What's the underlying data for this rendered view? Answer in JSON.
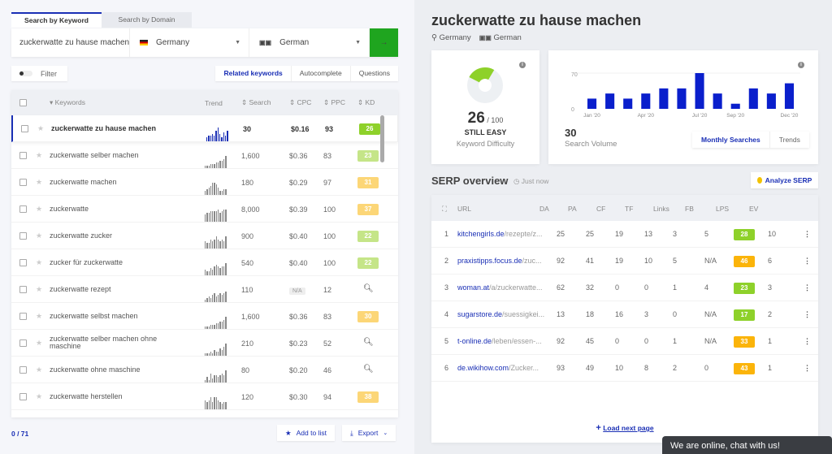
{
  "search": {
    "tabs": [
      "Search by Keyword",
      "Search by Domain"
    ],
    "keyword_value": "zuckerwatte zu hause machen",
    "country": "Germany",
    "language": "German",
    "go_icon": "arrow-right-icon"
  },
  "filter_label": "Filter",
  "modes": [
    "Related keywords",
    "Autocomplete",
    "Questions"
  ],
  "table": {
    "headers": {
      "keywords": "Keywords",
      "trend": "Trend",
      "search": "Search",
      "cpc": "CPC",
      "ppc": "PPC",
      "kd": "KD"
    },
    "rows": [
      {
        "kw": "zuckerwatte zu hause machen",
        "search": "30",
        "cpc": "$0.16",
        "ppc": "93",
        "kd": "26",
        "kd_color": "#8ed12a",
        "trend": [
          2,
          3,
          3,
          4,
          3,
          6,
          8,
          4,
          2,
          5,
          3,
          6
        ]
      },
      {
        "kw": "zuckerwatte selber machen",
        "search": "1,600",
        "cpc": "$0.36",
        "ppc": "83",
        "kd": "23",
        "kd_color": "#c5e588",
        "trend": [
          1,
          1,
          1,
          2,
          2,
          2,
          3,
          3,
          4,
          4,
          5,
          7
        ]
      },
      {
        "kw": "zuckerwatte machen",
        "search": "180",
        "cpc": "$0.29",
        "ppc": "97",
        "kd": "31",
        "kd_color": "#fcd677",
        "trend": [
          2,
          3,
          4,
          5,
          7,
          7,
          6,
          4,
          2,
          2,
          3,
          3
        ]
      },
      {
        "kw": "zuckerwatte",
        "search": "8,000",
        "cpc": "$0.39",
        "ppc": "100",
        "kd": "37",
        "kd_color": "#fcd677",
        "trend": [
          4,
          5,
          5,
          6,
          6,
          6,
          6,
          7,
          5,
          6,
          7,
          7
        ]
      },
      {
        "kw": "zuckerwatte zucker",
        "search": "900",
        "cpc": "$0.40",
        "ppc": "100",
        "kd": "22",
        "kd_color": "#c5e588",
        "trend": [
          4,
          3,
          3,
          5,
          4,
          5,
          7,
          5,
          4,
          5,
          4,
          7
        ]
      },
      {
        "kw": "zucker für zuckerwatte",
        "search": "540",
        "cpc": "$0.40",
        "ppc": "100",
        "kd": "22",
        "kd_color": "#c5e588",
        "trend": [
          3,
          2,
          2,
          4,
          3,
          5,
          6,
          5,
          4,
          5,
          5,
          7
        ]
      },
      {
        "kw": "zuckerwatte rezept",
        "search": "110",
        "cpc": "N/A",
        "ppc": "12",
        "kd": "",
        "kd_color": "",
        "trend": [
          1,
          2,
          3,
          2,
          4,
          5,
          3,
          4,
          5,
          4,
          5,
          6
        ]
      },
      {
        "kw": "zuckerwatte selbst machen",
        "search": "1,600",
        "cpc": "$0.36",
        "ppc": "83",
        "kd": "30",
        "kd_color": "#fcd677",
        "trend": [
          1,
          1,
          1,
          2,
          2,
          2,
          3,
          3,
          4,
          4,
          5,
          7
        ]
      },
      {
        "kw": "zuckerwatte selber machen ohne maschine",
        "search": "210",
        "cpc": "$0.23",
        "ppc": "52",
        "kd": "",
        "kd_color": "",
        "trend": [
          1,
          1,
          1,
          2,
          1,
          3,
          2,
          2,
          4,
          3,
          5,
          7
        ]
      },
      {
        "kw": "zuckerwatte ohne maschine",
        "search": "80",
        "cpc": "$0.20",
        "ppc": "46",
        "kd": "",
        "kd_color": "",
        "trend": [
          1,
          3,
          1,
          5,
          2,
          4,
          4,
          3,
          4,
          5,
          4,
          7
        ]
      },
      {
        "kw": "zuckerwatte herstellen",
        "search": "120",
        "cpc": "$0.30",
        "ppc": "94",
        "kd": "38",
        "kd_color": "#fcd677",
        "trend": [
          5,
          4,
          5,
          7,
          4,
          7,
          7,
          5,
          4,
          3,
          4,
          4
        ]
      }
    ]
  },
  "footer": {
    "count": "0 / 71",
    "add_to_list": "Add to list",
    "export": "Export"
  },
  "detail": {
    "title": "zuckerwatte zu hause machen",
    "country": "Germany",
    "language": "German",
    "kd": {
      "value": "26",
      "max": "/ 100",
      "label": "STILL EASY",
      "caption": "Keyword Difficulty",
      "color": "#8ed12a"
    },
    "volume": {
      "value": "30",
      "caption": "Search Volume",
      "toggles": [
        "Monthly Searches",
        "Trends"
      ]
    }
  },
  "chart_data": {
    "type": "bar",
    "categories": [
      "Jan '20",
      "Feb '20",
      "Mar '20",
      "Apr '20",
      "May '20",
      "Jun '20",
      "Jul '20",
      "Aug '20",
      "Sep '20",
      "Oct '20",
      "Nov '20",
      "Dec '20"
    ],
    "tick_labels": [
      "Jan '20",
      "Apr '20",
      "Jul '20",
      "Sep '20",
      "Dec '20"
    ],
    "values": [
      20,
      30,
      20,
      30,
      40,
      40,
      70,
      30,
      10,
      40,
      30,
      50
    ],
    "yticks": [
      "0",
      "70"
    ],
    "ylim": [
      0,
      70
    ],
    "color": "#0a1fcc"
  },
  "serp": {
    "title": "SERP overview",
    "time": "Just now",
    "analyze": "Analyze SERP",
    "headers": [
      "URL",
      "DA",
      "PA",
      "CF",
      "TF",
      "Links",
      "FB",
      "LPS",
      "EV"
    ],
    "rows": [
      {
        "n": "1",
        "domain": "kitchengirls.de",
        "path": "/rezepte/z...",
        "da": "25",
        "pa": "25",
        "cf": "19",
        "tf": "13",
        "links": "3",
        "fb": "5",
        "lps": "28",
        "lps_color": "#8ed12a",
        "ev": "10"
      },
      {
        "n": "2",
        "domain": "praxistipps.focus.de",
        "path": "/zuc...",
        "da": "92",
        "pa": "41",
        "cf": "19",
        "tf": "10",
        "links": "5",
        "fb": "N/A",
        "lps": "46",
        "lps_color": "#fbb40a",
        "ev": "6"
      },
      {
        "n": "3",
        "domain": "woman.at",
        "path": "/a/zuckerwatte...",
        "da": "62",
        "pa": "32",
        "cf": "0",
        "tf": "0",
        "links": "1",
        "fb": "4",
        "lps": "23",
        "lps_color": "#8ed12a",
        "ev": "3"
      },
      {
        "n": "4",
        "domain": "sugarstore.de",
        "path": "/suessigkei...",
        "da": "13",
        "pa": "18",
        "cf": "16",
        "tf": "3",
        "links": "0",
        "fb": "N/A",
        "lps": "17",
        "lps_color": "#8ed12a",
        "ev": "2"
      },
      {
        "n": "5",
        "domain": "t-online.de",
        "path": "/leben/essen-...",
        "da": "92",
        "pa": "45",
        "cf": "0",
        "tf": "0",
        "links": "1",
        "fb": "N/A",
        "lps": "33",
        "lps_color": "#fbb40a",
        "ev": "1"
      },
      {
        "n": "6",
        "domain": "de.wikihow.com",
        "path": "/Zucker...",
        "da": "93",
        "pa": "49",
        "cf": "10",
        "tf": "8",
        "links": "2",
        "fb": "0",
        "lps": "43",
        "lps_color": "#fbb40a",
        "ev": "1"
      }
    ],
    "load_next": "Load next page"
  },
  "chat": "We are online, chat with us!"
}
